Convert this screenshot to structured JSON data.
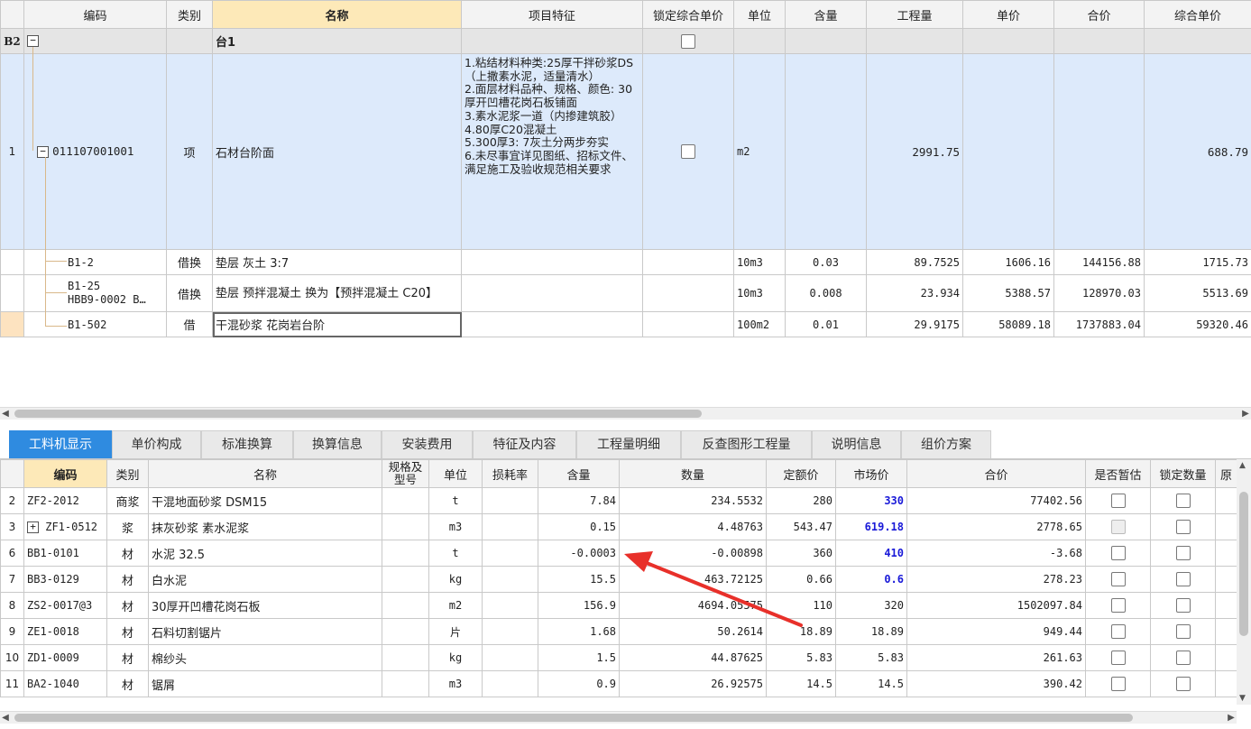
{
  "top_table": {
    "headers": [
      "编码",
      "类别",
      "名称",
      "项目特征",
      "锁定综合单价",
      "单位",
      "含量",
      "工程量",
      "单价",
      "合价",
      "综合单价"
    ],
    "group_row": {
      "num": "B2",
      "name": "台1"
    },
    "item_row": {
      "num": "1",
      "code": "011107001001",
      "type": "项",
      "name": "石材台阶面",
      "features": "1.粘结材料种类:25厚干拌砂浆DS（上撒素水泥，适量清水）\n2.面层材料品种、规格、颜色: 30厚开凹槽花岗石板铺面\n3.素水泥浆一道（内掺建筑胶）\n4.80厚C20混凝土\n5.300厚3: 7灰土分两步夯实\n6.未尽事宜详见图纸、招标文件、满足施工及验收规范相关要求",
      "unit": "m2",
      "quantity": "2991.75",
      "comp_price": "688.79"
    },
    "sub_rows": [
      {
        "code": "B1-2",
        "type": "借换",
        "name": "垫层 灰土 3:7",
        "unit": "10m3",
        "content": "0.03",
        "quantity": "89.7525",
        "price": "1606.16",
        "total": "144156.88",
        "comp_price": "1715.73"
      },
      {
        "code": "B1-25\nHBB9-0002 B…",
        "type": "借换",
        "name": "垫层 预拌混凝土  换为【预拌混凝土 C20】",
        "unit": "10m3",
        "content": "0.008",
        "quantity": "23.934",
        "price": "5388.57",
        "total": "128970.03",
        "comp_price": "5513.69"
      },
      {
        "code": "B1-502",
        "type": "借",
        "name": "干混砂浆 花岗岩台阶",
        "unit": "100m2",
        "content": "0.01",
        "quantity": "29.9175",
        "price": "58089.18",
        "total": "1737883.04",
        "comp_price": "59320.46"
      }
    ]
  },
  "tabs": [
    "工料机显示",
    "单价构成",
    "标准换算",
    "换算信息",
    "安装费用",
    "特征及内容",
    "工程量明细",
    "反查图形工程量",
    "说明信息",
    "组价方案"
  ],
  "bottom_table": {
    "headers": [
      "编码",
      "类别",
      "名称",
      "规格及型号",
      "单位",
      "损耗率",
      "含量",
      "数量",
      "定额价",
      "市场价",
      "合价",
      "是否暂估",
      "锁定数量",
      "原"
    ],
    "rows": [
      {
        "num": "2",
        "code": "ZF2-2012",
        "type": "商浆",
        "name": "干混地面砂浆 DSM15",
        "unit": "t",
        "content": "7.84",
        "qty": "234.5532",
        "base": "280",
        "market": "330",
        "total": "77402.56"
      },
      {
        "num": "3",
        "code": "ZF1-0512",
        "type": "浆",
        "name": "抹灰砂浆 素水泥浆",
        "unit": "m3",
        "content": "0.15",
        "qty": "4.48763",
        "base": "543.47",
        "market": "619.18",
        "total": "2778.65"
      },
      {
        "num": "6",
        "code": "BB1-0101",
        "type": "材",
        "name": "水泥 32.5",
        "unit": "t",
        "content": "-0.0003",
        "qty": "-0.00898",
        "base": "360",
        "market": "410",
        "total": "-3.68"
      },
      {
        "num": "7",
        "code": "BB3-0129",
        "type": "材",
        "name": "白水泥",
        "unit": "kg",
        "content": "15.5",
        "qty": "463.72125",
        "base": "0.66",
        "market": "0.6",
        "total": "278.23"
      },
      {
        "num": "8",
        "code": "ZS2-0017@3",
        "type": "材",
        "name": "30厚开凹槽花岗石板",
        "unit": "m2",
        "content": "156.9",
        "qty": "4694.05575",
        "base": "110",
        "market": "320",
        "total": "1502097.84"
      },
      {
        "num": "9",
        "code": "ZE1-0018",
        "type": "材",
        "name": "石料切割锯片",
        "unit": "片",
        "content": "1.68",
        "qty": "50.2614",
        "base": "18.89",
        "market": "18.89",
        "total": "949.44"
      },
      {
        "num": "10",
        "code": "ZD1-0009",
        "type": "材",
        "name": "棉纱头",
        "unit": "kg",
        "content": "1.5",
        "qty": "44.87625",
        "base": "5.83",
        "market": "5.83",
        "total": "261.63"
      },
      {
        "num": "11",
        "code": "BA2-1040",
        "type": "材",
        "name": "锯屑",
        "unit": "m3",
        "content": "0.9",
        "qty": "26.92575",
        "base": "14.5",
        "market": "14.5",
        "total": "390.42"
      }
    ]
  },
  "icons": {
    "collapse": "minus-box-icon",
    "expand": "plus-box-icon"
  },
  "colors": {
    "accent_tab": "#2f8be0",
    "market_price": "#1a1ad8",
    "annotation_arrow": "#e8302a",
    "selected_row": "#ddeafb"
  }
}
